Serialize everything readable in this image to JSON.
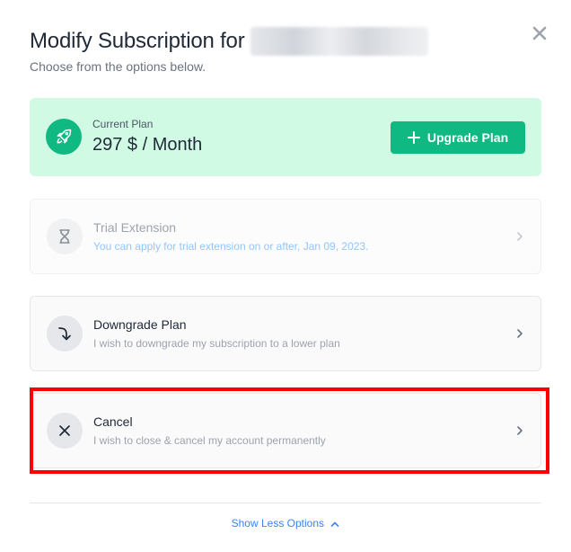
{
  "header": {
    "title": "Modify Subscription for",
    "subtitle": "Choose from the options below."
  },
  "current_plan": {
    "caption": "Current Plan",
    "price": "297 $ / Month",
    "upgrade_label": "Upgrade Plan"
  },
  "options": [
    {
      "title": "Trial Extension",
      "description": "You can apply for trial extension on or after, Jan 09, 2023.",
      "icon": "hourglass-icon",
      "disabled": true
    },
    {
      "title": "Downgrade Plan",
      "description": "I wish to downgrade my subscription to a lower plan",
      "icon": "arrow-down-turn-icon"
    },
    {
      "title": "Cancel",
      "description": "I wish to close & cancel my account permanently",
      "icon": "x-icon",
      "highlighted": true
    }
  ],
  "footer": {
    "show_less_label": "Show Less Options"
  },
  "colors": {
    "accent": "#10b981",
    "plan_bg": "#d1fae5",
    "highlight": "#ff0000",
    "link": "#3b82f6"
  }
}
